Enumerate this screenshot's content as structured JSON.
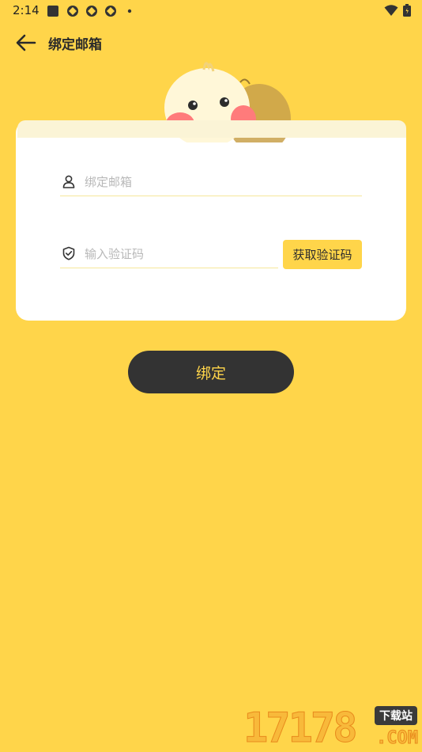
{
  "status_bar": {
    "time": "2:14",
    "icons": [
      "app-notification-icon",
      "notification-icon",
      "notification-icon",
      "notification-icon",
      "dot-icon",
      "wifi-icon",
      "battery-icon"
    ]
  },
  "app_bar": {
    "title": "绑定邮箱"
  },
  "form": {
    "email_placeholder": "绑定邮箱",
    "code_placeholder": "输入验证码",
    "get_code_label": "获取验证码",
    "submit_label": "绑定"
  },
  "watermark": {
    "number": "17178",
    "tag": "下载站",
    "domain": ".COM"
  },
  "colors": {
    "background": "#FFD54A",
    "card": "#FFFFFF",
    "button_dark": "#333333",
    "button_text": "#FFD54A",
    "accent": "#FFD54A"
  }
}
